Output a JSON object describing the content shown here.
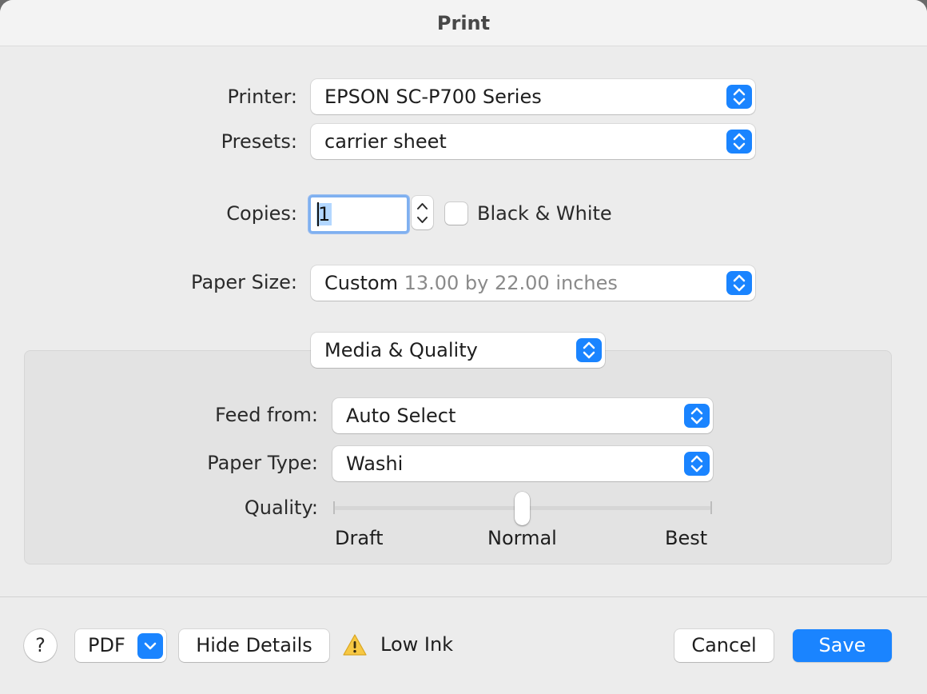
{
  "window": {
    "title": "Print"
  },
  "printer": {
    "label": "Printer:",
    "value": "EPSON SC-P700 Series"
  },
  "presets": {
    "label": "Presets:",
    "value": "carrier sheet"
  },
  "copies": {
    "label": "Copies:",
    "value": "1",
    "black_white_label": "Black & White",
    "black_white_checked": false
  },
  "paper_size": {
    "label": "Paper Size:",
    "value": "Custom",
    "detail": "13.00 by 22.00 inches"
  },
  "panel": {
    "value": "Media & Quality"
  },
  "feed_from": {
    "label": "Feed from:",
    "value": "Auto Select"
  },
  "paper_type": {
    "label": "Paper Type:",
    "value": "Washi"
  },
  "quality": {
    "label": "Quality:",
    "levels": [
      "Draft",
      "Normal",
      "Best"
    ],
    "selected": "Normal"
  },
  "footer": {
    "help_label": "?",
    "pdf_label": "PDF",
    "hide_details_label": "Hide Details",
    "status_text": "Low Ink",
    "cancel_label": "Cancel",
    "save_label": "Save"
  },
  "icons": {
    "popup": "up-down-chevron-icon",
    "pdf_menu": "chevron-down-icon",
    "status": "warning-icon"
  },
  "colors": {
    "accent": "#1a84ff",
    "warning": "#f7c843"
  }
}
